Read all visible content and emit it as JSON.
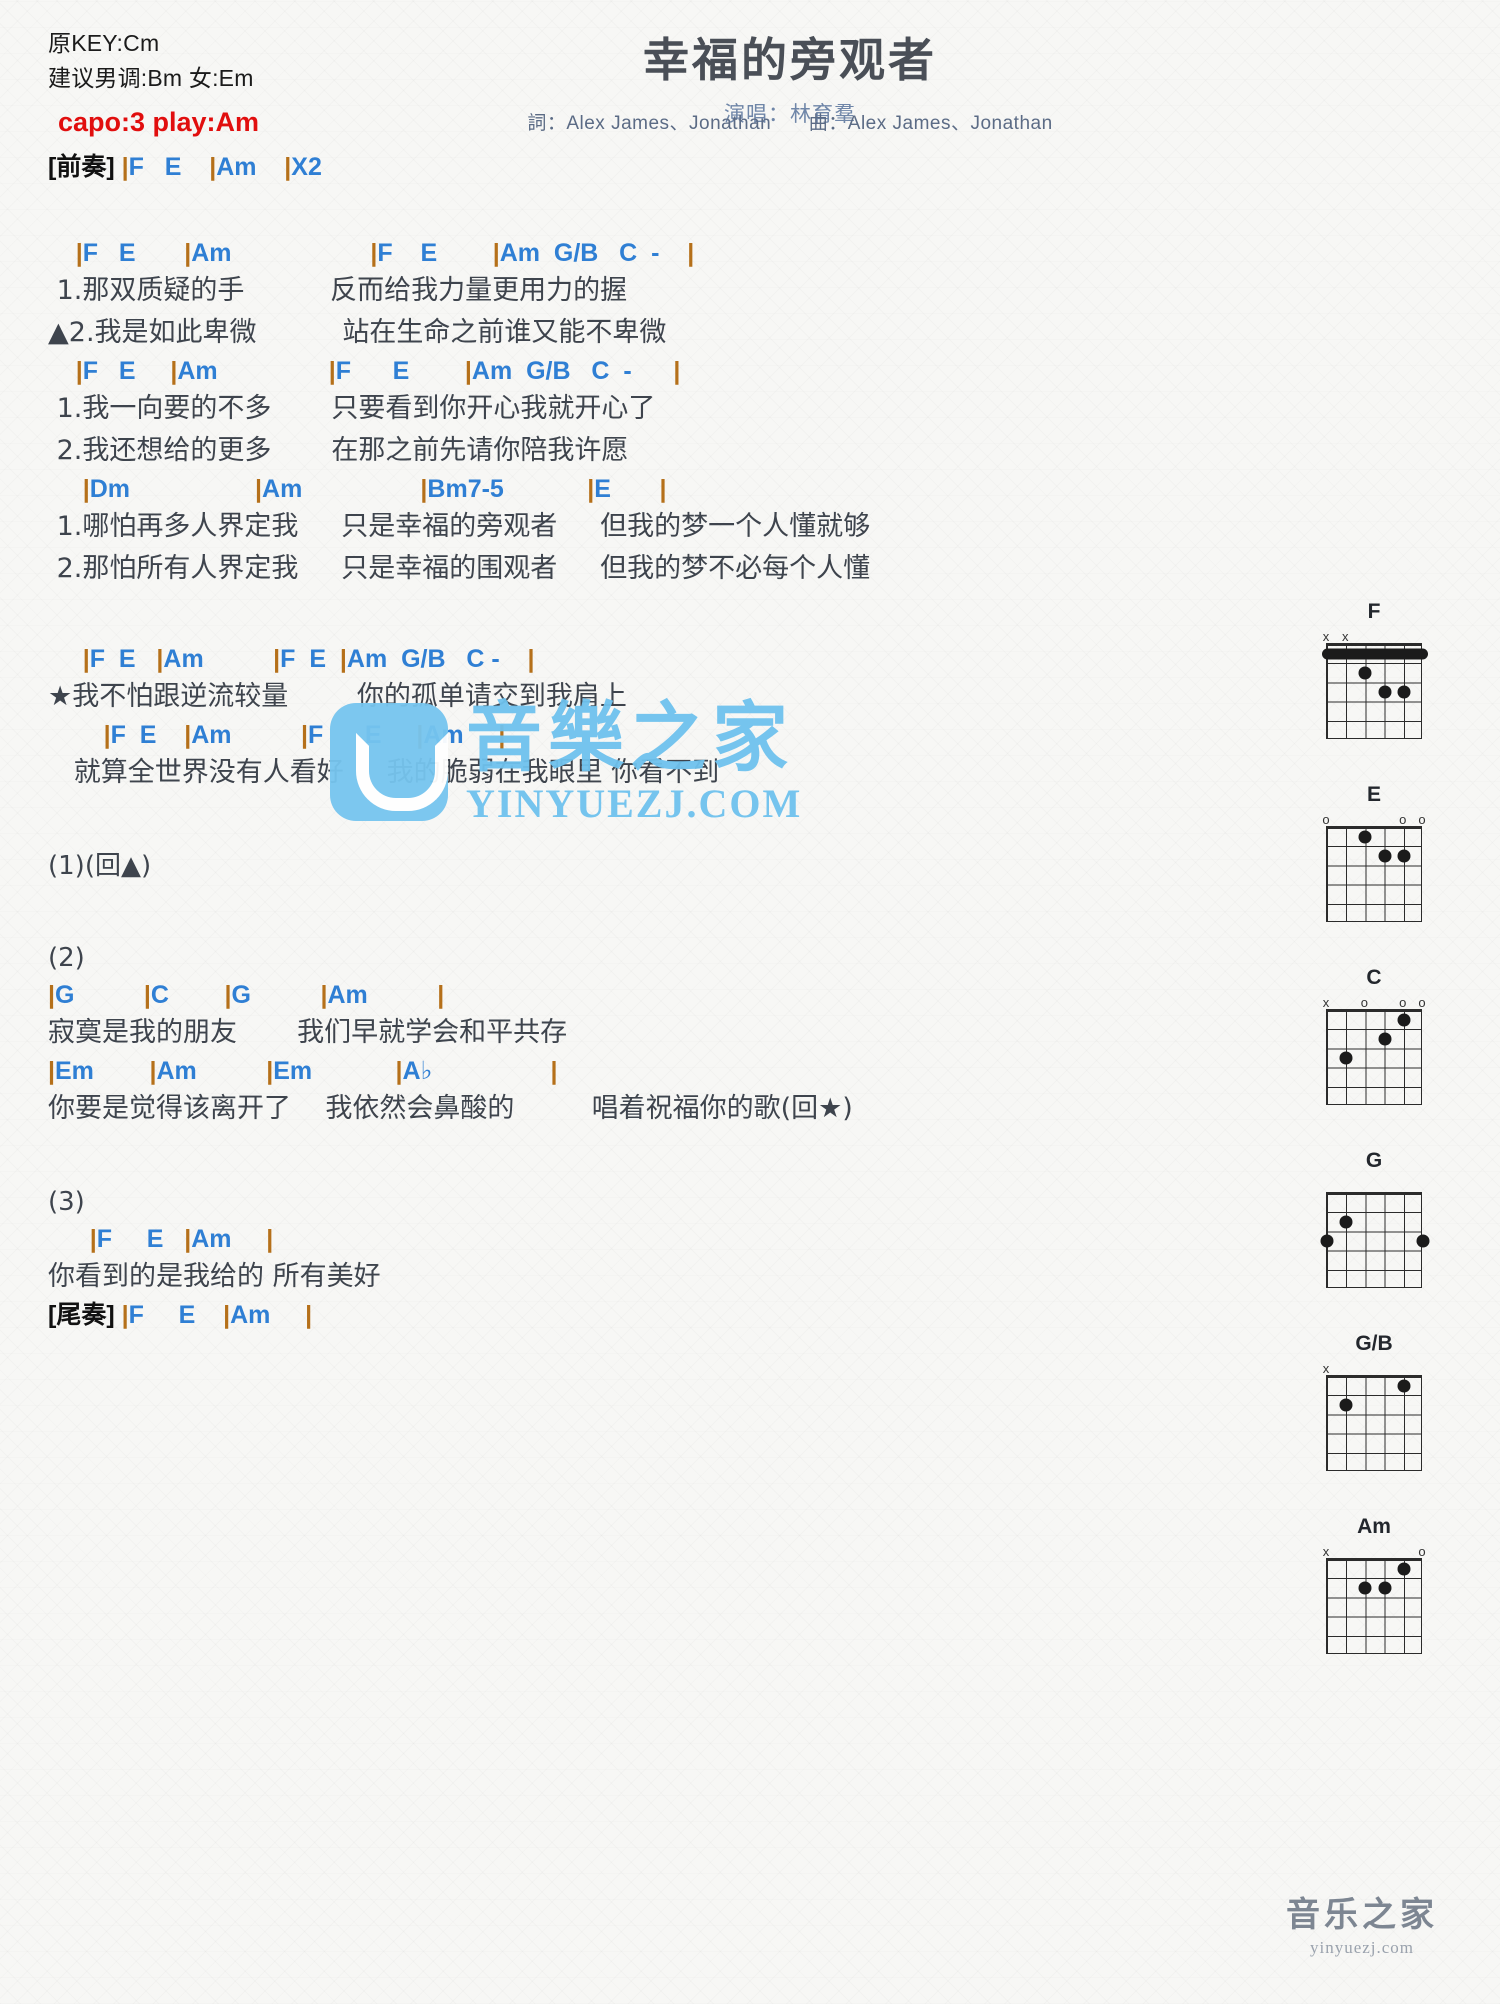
{
  "header": {
    "orig_key": "原KEY:Cm",
    "suggest_key": "建议男调:Bm 女:Em",
    "capo": "capo:3 play:Am",
    "title": "幸福的旁观者",
    "singer": "演唱：林育羣",
    "lyricist": "詞：Alex James、Jonathan",
    "composer": "曲：Alex James、Jonathan",
    "capo_color": "#e10e0e",
    "chord_color": "#2f7fd4",
    "bar_color": "#b5701a"
  },
  "intro": {
    "tag": "[前奏]",
    "chords": "|F   E    |Am    |X2"
  },
  "sections": [
    {
      "name": "verse-1",
      "lines": [
        {
          "type": "chord",
          "text": "    |F   E       |Am                    |F    E        |Am  G/B   C  -    |"
        },
        {
          "type": "lyric",
          "text": " 1.那双质疑的手          反而给我力量更用力的握"
        },
        {
          "type": "lyric",
          "text": "▲2.我是如此卑微          站在生命之前谁又能不卑微"
        },
        {
          "type": "chord",
          "text": "    |F   E     |Am                |F      E        |Am  G/B   C  -      |"
        },
        {
          "type": "lyric",
          "text": " 1.我一向要的不多       只要看到你开心我就开心了"
        },
        {
          "type": "lyric",
          "text": " 2.我还想给的更多       在那之前先请你陪我许愿"
        },
        {
          "type": "chord",
          "text": "     |Dm                  |Am                 |Bm7-5            |E       |"
        },
        {
          "type": "lyric",
          "text": " 1.哪怕再多人界定我     只是幸福的旁观者     但我的梦一个人懂就够"
        },
        {
          "type": "lyric",
          "text": " 2.那怕所有人界定我     只是幸福的围观者     但我的梦不必每个人懂"
        }
      ]
    },
    {
      "name": "chorus",
      "lines": [
        {
          "type": "chord",
          "text": "     |F  E   |Am          |F  E  |Am  G/B   C -    |"
        },
        {
          "type": "lyric",
          "text": "★我不怕跟逆流较量        你的孤单请交到我肩上"
        },
        {
          "type": "chord",
          "text": "        |F  E    |Am          |F      E     |Am     |"
        },
        {
          "type": "lyric",
          "text": "   就算全世界没有人看好     我的脆弱在我眼里 你看不到"
        }
      ]
    },
    {
      "name": "repeat-1",
      "lines": [
        {
          "type": "plain",
          "text": "(1)(回▲)"
        }
      ]
    },
    {
      "name": "section-2",
      "lines": [
        {
          "type": "plain",
          "text": "(2)"
        },
        {
          "type": "chord",
          "text": "|G          |C        |G          |Am          |"
        },
        {
          "type": "lyric",
          "text": "寂寞是我的朋友       我们早就学会和平共存"
        },
        {
          "type": "chord",
          "text": "|Em        |Am          |Em            |A♭                 |"
        },
        {
          "type": "lyric",
          "text": "你要是觉得该离开了    我依然会鼻酸的         唱着祝福你的歌(回★)"
        }
      ]
    },
    {
      "name": "section-3",
      "lines": [
        {
          "type": "plain",
          "text": "(3)"
        },
        {
          "type": "chord",
          "text": "      |F     E   |Am     |"
        },
        {
          "type": "lyric",
          "text": "你看到的是我给的 所有美好"
        },
        {
          "type": "outro",
          "tag": "[尾奏]",
          "text": " |F     E    |Am     |"
        }
      ]
    }
  ],
  "watermark": {
    "cn": "音樂之家",
    "en": "YINYUEZJ.COM",
    "logo_icon": "smile-logo-icon",
    "color": "#6fc2ee"
  },
  "footer_logo": {
    "cn": "音乐之家",
    "en": "yinyuezj.com"
  },
  "chord_diagrams": [
    {
      "name": "F",
      "markers": [
        {
          "pos": 1,
          "sym": "x"
        },
        {
          "pos": 2,
          "sym": "x"
        }
      ],
      "barre": {
        "fret": 1,
        "from": 1,
        "to": 6
      },
      "dots": [
        {
          "string": 3,
          "fret": 2
        },
        {
          "string": 4,
          "fret": 3
        },
        {
          "string": 5,
          "fret": 3
        }
      ]
    },
    {
      "name": "E",
      "markers": [
        {
          "pos": 1,
          "sym": "o"
        },
        {
          "pos": 5,
          "sym": "o"
        },
        {
          "pos": 6,
          "sym": "o"
        }
      ],
      "barre": null,
      "dots": [
        {
          "string": 3,
          "fret": 1
        },
        {
          "string": 4,
          "fret": 2
        },
        {
          "string": 5,
          "fret": 2
        }
      ]
    },
    {
      "name": "C",
      "markers": [
        {
          "pos": 1,
          "sym": "x"
        },
        {
          "pos": 3,
          "sym": "o"
        },
        {
          "pos": 5,
          "sym": "o"
        },
        {
          "pos": 6,
          "sym": "o"
        }
      ],
      "barre": null,
      "dots": [
        {
          "string": 2,
          "fret": 3
        },
        {
          "string": 4,
          "fret": 2
        },
        {
          "string": 5,
          "fret": 1
        }
      ]
    },
    {
      "name": "G",
      "markers": [],
      "barre": null,
      "dots": [
        {
          "string": 1,
          "fret": 3
        },
        {
          "string": 2,
          "fret": 2
        },
        {
          "string": 6,
          "fret": 3
        }
      ]
    },
    {
      "name": "G/B",
      "markers": [
        {
          "pos": 1,
          "sym": "x"
        }
      ],
      "barre": null,
      "dots": [
        {
          "string": 2,
          "fret": 2
        },
        {
          "string": 5,
          "fret": 1
        }
      ]
    },
    {
      "name": "Am",
      "markers": [
        {
          "pos": 1,
          "sym": "x"
        },
        {
          "pos": 6,
          "sym": "o"
        }
      ],
      "barre": null,
      "dots": [
        {
          "string": 3,
          "fret": 2
        },
        {
          "string": 4,
          "fret": 2
        },
        {
          "string": 5,
          "fret": 1
        }
      ]
    }
  ]
}
